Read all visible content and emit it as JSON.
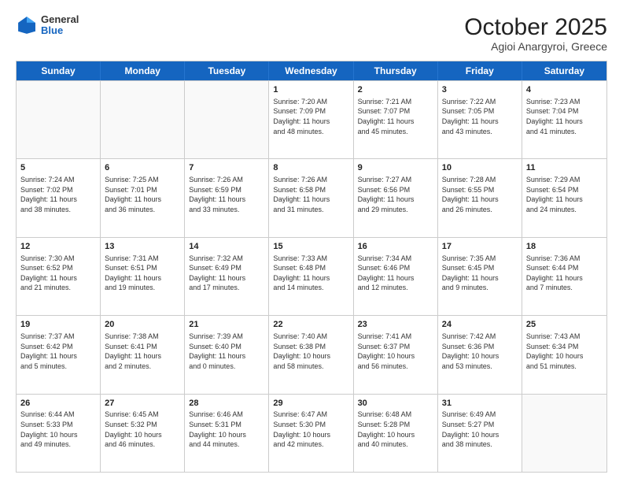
{
  "header": {
    "logo": {
      "general": "General",
      "blue": "Blue"
    },
    "title": "October 2025",
    "subtitle": "Agioi Anargyroi, Greece"
  },
  "weekdays": [
    "Sunday",
    "Monday",
    "Tuesday",
    "Wednesday",
    "Thursday",
    "Friday",
    "Saturday"
  ],
  "rows": [
    [
      {
        "day": "",
        "info": ""
      },
      {
        "day": "",
        "info": ""
      },
      {
        "day": "",
        "info": ""
      },
      {
        "day": "1",
        "info": "Sunrise: 7:20 AM\nSunset: 7:09 PM\nDaylight: 11 hours\nand 48 minutes."
      },
      {
        "day": "2",
        "info": "Sunrise: 7:21 AM\nSunset: 7:07 PM\nDaylight: 11 hours\nand 45 minutes."
      },
      {
        "day": "3",
        "info": "Sunrise: 7:22 AM\nSunset: 7:05 PM\nDaylight: 11 hours\nand 43 minutes."
      },
      {
        "day": "4",
        "info": "Sunrise: 7:23 AM\nSunset: 7:04 PM\nDaylight: 11 hours\nand 41 minutes."
      }
    ],
    [
      {
        "day": "5",
        "info": "Sunrise: 7:24 AM\nSunset: 7:02 PM\nDaylight: 11 hours\nand 38 minutes."
      },
      {
        "day": "6",
        "info": "Sunrise: 7:25 AM\nSunset: 7:01 PM\nDaylight: 11 hours\nand 36 minutes."
      },
      {
        "day": "7",
        "info": "Sunrise: 7:26 AM\nSunset: 6:59 PM\nDaylight: 11 hours\nand 33 minutes."
      },
      {
        "day": "8",
        "info": "Sunrise: 7:26 AM\nSunset: 6:58 PM\nDaylight: 11 hours\nand 31 minutes."
      },
      {
        "day": "9",
        "info": "Sunrise: 7:27 AM\nSunset: 6:56 PM\nDaylight: 11 hours\nand 29 minutes."
      },
      {
        "day": "10",
        "info": "Sunrise: 7:28 AM\nSunset: 6:55 PM\nDaylight: 11 hours\nand 26 minutes."
      },
      {
        "day": "11",
        "info": "Sunrise: 7:29 AM\nSunset: 6:54 PM\nDaylight: 11 hours\nand 24 minutes."
      }
    ],
    [
      {
        "day": "12",
        "info": "Sunrise: 7:30 AM\nSunset: 6:52 PM\nDaylight: 11 hours\nand 21 minutes."
      },
      {
        "day": "13",
        "info": "Sunrise: 7:31 AM\nSunset: 6:51 PM\nDaylight: 11 hours\nand 19 minutes."
      },
      {
        "day": "14",
        "info": "Sunrise: 7:32 AM\nSunset: 6:49 PM\nDaylight: 11 hours\nand 17 minutes."
      },
      {
        "day": "15",
        "info": "Sunrise: 7:33 AM\nSunset: 6:48 PM\nDaylight: 11 hours\nand 14 minutes."
      },
      {
        "day": "16",
        "info": "Sunrise: 7:34 AM\nSunset: 6:46 PM\nDaylight: 11 hours\nand 12 minutes."
      },
      {
        "day": "17",
        "info": "Sunrise: 7:35 AM\nSunset: 6:45 PM\nDaylight: 11 hours\nand 9 minutes."
      },
      {
        "day": "18",
        "info": "Sunrise: 7:36 AM\nSunset: 6:44 PM\nDaylight: 11 hours\nand 7 minutes."
      }
    ],
    [
      {
        "day": "19",
        "info": "Sunrise: 7:37 AM\nSunset: 6:42 PM\nDaylight: 11 hours\nand 5 minutes."
      },
      {
        "day": "20",
        "info": "Sunrise: 7:38 AM\nSunset: 6:41 PM\nDaylight: 11 hours\nand 2 minutes."
      },
      {
        "day": "21",
        "info": "Sunrise: 7:39 AM\nSunset: 6:40 PM\nDaylight: 11 hours\nand 0 minutes."
      },
      {
        "day": "22",
        "info": "Sunrise: 7:40 AM\nSunset: 6:38 PM\nDaylight: 10 hours\nand 58 minutes."
      },
      {
        "day": "23",
        "info": "Sunrise: 7:41 AM\nSunset: 6:37 PM\nDaylight: 10 hours\nand 56 minutes."
      },
      {
        "day": "24",
        "info": "Sunrise: 7:42 AM\nSunset: 6:36 PM\nDaylight: 10 hours\nand 53 minutes."
      },
      {
        "day": "25",
        "info": "Sunrise: 7:43 AM\nSunset: 6:34 PM\nDaylight: 10 hours\nand 51 minutes."
      }
    ],
    [
      {
        "day": "26",
        "info": "Sunrise: 6:44 AM\nSunset: 5:33 PM\nDaylight: 10 hours\nand 49 minutes."
      },
      {
        "day": "27",
        "info": "Sunrise: 6:45 AM\nSunset: 5:32 PM\nDaylight: 10 hours\nand 46 minutes."
      },
      {
        "day": "28",
        "info": "Sunrise: 6:46 AM\nSunset: 5:31 PM\nDaylight: 10 hours\nand 44 minutes."
      },
      {
        "day": "29",
        "info": "Sunrise: 6:47 AM\nSunset: 5:30 PM\nDaylight: 10 hours\nand 42 minutes."
      },
      {
        "day": "30",
        "info": "Sunrise: 6:48 AM\nSunset: 5:28 PM\nDaylight: 10 hours\nand 40 minutes."
      },
      {
        "day": "31",
        "info": "Sunrise: 6:49 AM\nSunset: 5:27 PM\nDaylight: 10 hours\nand 38 minutes."
      },
      {
        "day": "",
        "info": ""
      }
    ]
  ]
}
